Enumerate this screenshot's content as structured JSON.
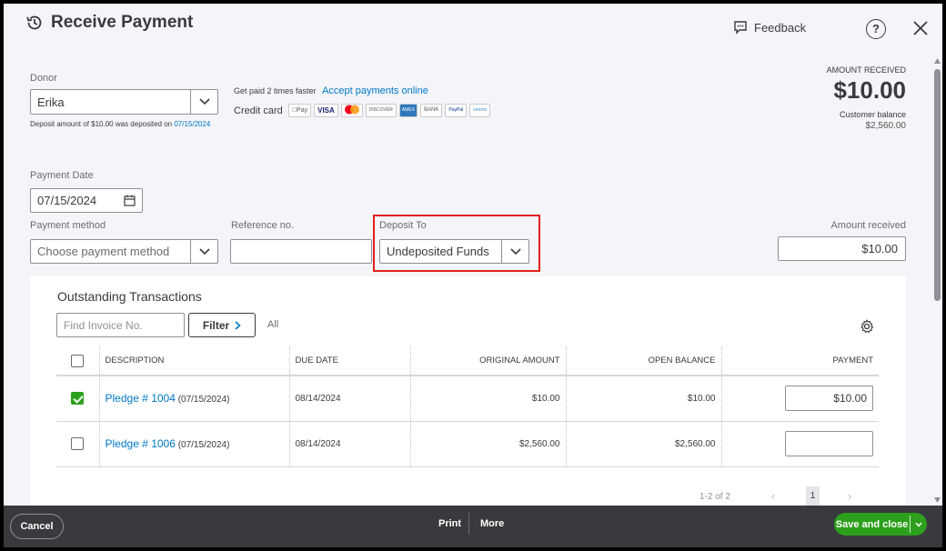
{
  "header": {
    "title": "Receive Payment",
    "feedback_label": "Feedback",
    "help_label": "?"
  },
  "donor": {
    "label": "Donor",
    "value": "Erika",
    "deposit_note_prefix": "Deposit amount of $10.00 was deposited on",
    "deposit_note_date": "07/15/2024"
  },
  "online": {
    "get_paid_text": "Get paid 2 times faster",
    "accept_link": "Accept payments online",
    "credit_card_label": "Credit card",
    "methods": [
      "Pay",
      "VISA",
      "",
      "DISCOVER",
      "AMEX",
      "BANK",
      "PayPal",
      "venmo"
    ]
  },
  "amount_received_summary": {
    "label": "AMOUNT RECEIVED",
    "value": "$10.00",
    "customer_balance_label": "Customer balance",
    "customer_balance_value": "$2,560.00"
  },
  "payment_date": {
    "label": "Payment Date",
    "value": "07/15/2024"
  },
  "payment_method": {
    "label": "Payment method",
    "placeholder": "Choose payment method"
  },
  "reference": {
    "label": "Reference no.",
    "value": ""
  },
  "deposit_to": {
    "label": "Deposit To",
    "value": "Undeposited Funds",
    "highlight_color": "#e0201c"
  },
  "amount_received": {
    "label": "Amount received",
    "value": "$10.00"
  },
  "outstanding": {
    "title": "Outstanding Transactions",
    "find_placeholder": "Find Invoice No.",
    "filter_label": "Filter",
    "all_label": "All",
    "columns": [
      "DESCRIPTION",
      "DUE DATE",
      "ORIGINAL AMOUNT",
      "OPEN BALANCE",
      "PAYMENT"
    ],
    "rows": [
      {
        "link": "Pledge # 1004",
        "date": "(07/15/2024)",
        "due": "08/14/2024",
        "original": "$10.00",
        "open": "$10.00",
        "payment": "$10.00",
        "checked": true
      },
      {
        "link": "Pledge # 1006",
        "date": "(07/15/2024)",
        "due": "08/14/2024",
        "original": "$2,560.00",
        "open": "$2,560.00",
        "payment": "",
        "checked": false
      }
    ],
    "pagination": {
      "range": "1-2 of 2",
      "prev": "‹",
      "page": "1",
      "next": "›"
    }
  },
  "footer": {
    "cancel_label": "Cancel",
    "print_label": "Print",
    "more_label": "More",
    "save_label": "Save and close"
  },
  "colors": {
    "accent": "#2ca01c",
    "link": "#0077c5",
    "footer_bg": "#393a3d"
  }
}
